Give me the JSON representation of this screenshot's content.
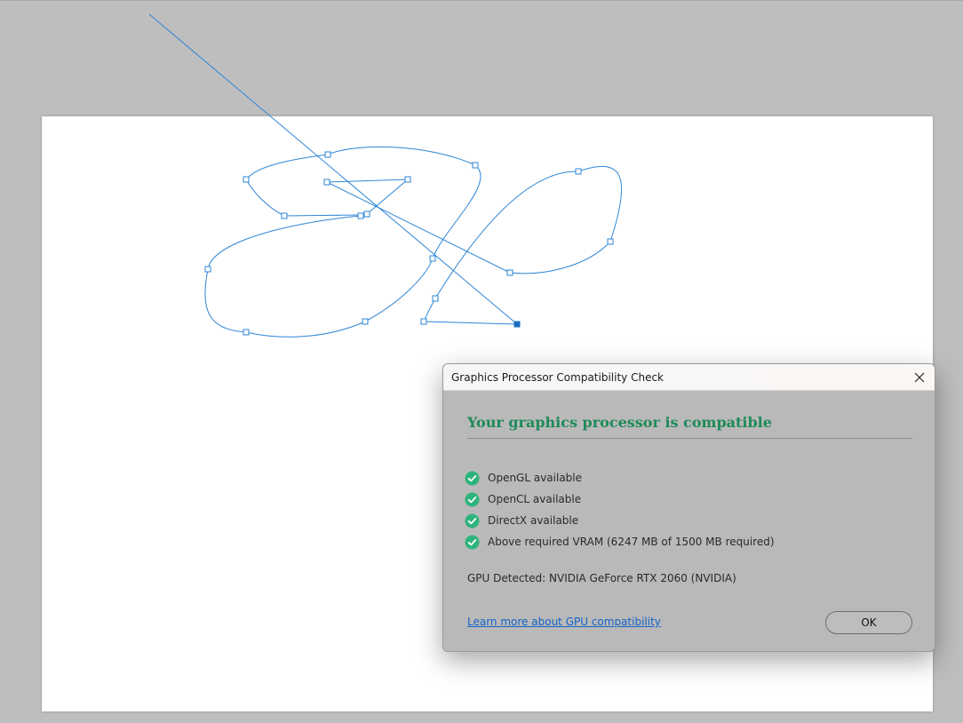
{
  "dialog": {
    "title": "Graphics Processor Compatibility Check",
    "heading": "Your graphics processor is compatible",
    "checks": [
      {
        "label": "OpenGL available",
        "icon": "check-circle-icon"
      },
      {
        "label": "OpenCL available",
        "icon": "check-circle-icon"
      },
      {
        "label": "DirectX available",
        "icon": "check-circle-icon"
      },
      {
        "label": "Above required VRAM (6247 MB of 1500 MB required)",
        "icon": "check-circle-icon"
      }
    ],
    "gpu_detected": "GPU Detected: NVIDIA GeForce RTX 2060 (NVIDIA)",
    "learn_more_link": "Learn more about GPU compatibility",
    "ok_label": "OK"
  },
  "colors": {
    "accent_green": "#1e8a5a",
    "check_green": "#2fb37c",
    "path_blue": "#2e86d6",
    "link_blue": "#1464c8"
  }
}
